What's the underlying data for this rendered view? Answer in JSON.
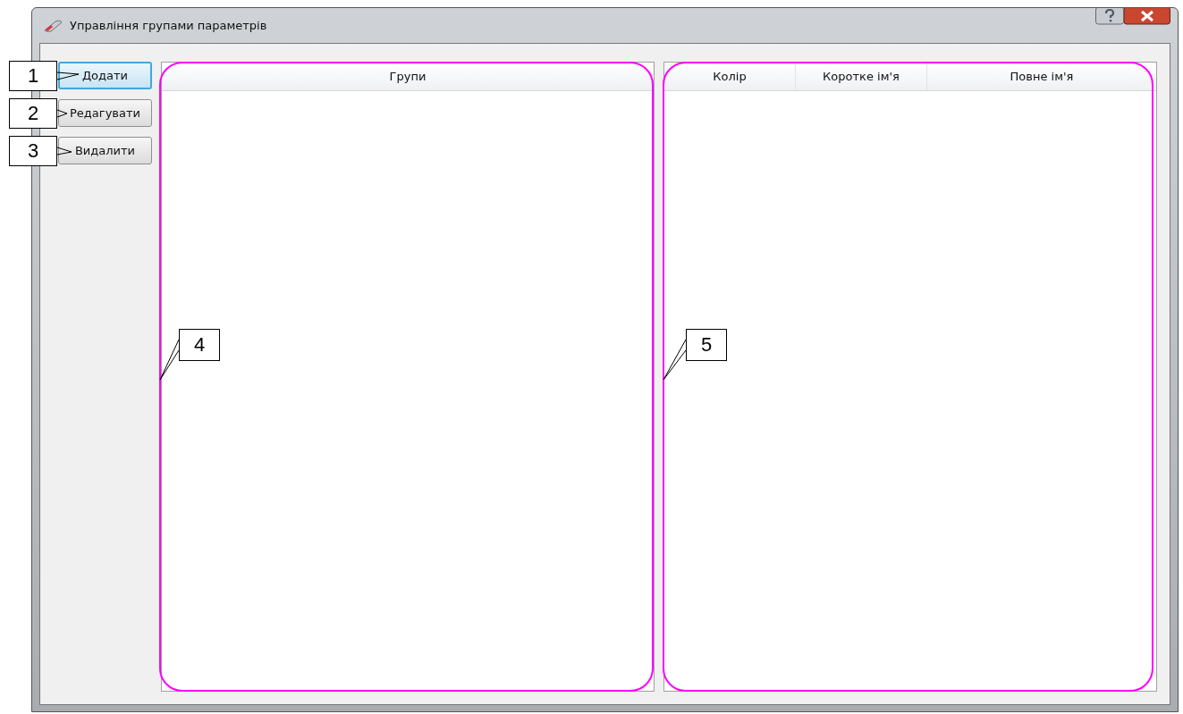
{
  "window": {
    "title": "Управління групами параметрів"
  },
  "buttons": [
    {
      "label": "Додати",
      "focused": true
    },
    {
      "label": "Редагувати",
      "focused": false
    },
    {
      "label": "Видалити",
      "focused": false
    }
  ],
  "groups_table": {
    "columns": [
      "Групи"
    ]
  },
  "parameters_table": {
    "columns": [
      "Колір",
      "Коротке ім'я",
      "Повне ім'я"
    ]
  },
  "callouts": [
    {
      "label": "1"
    },
    {
      "label": "2"
    },
    {
      "label": "3"
    },
    {
      "label": "4"
    },
    {
      "label": "5"
    }
  ]
}
